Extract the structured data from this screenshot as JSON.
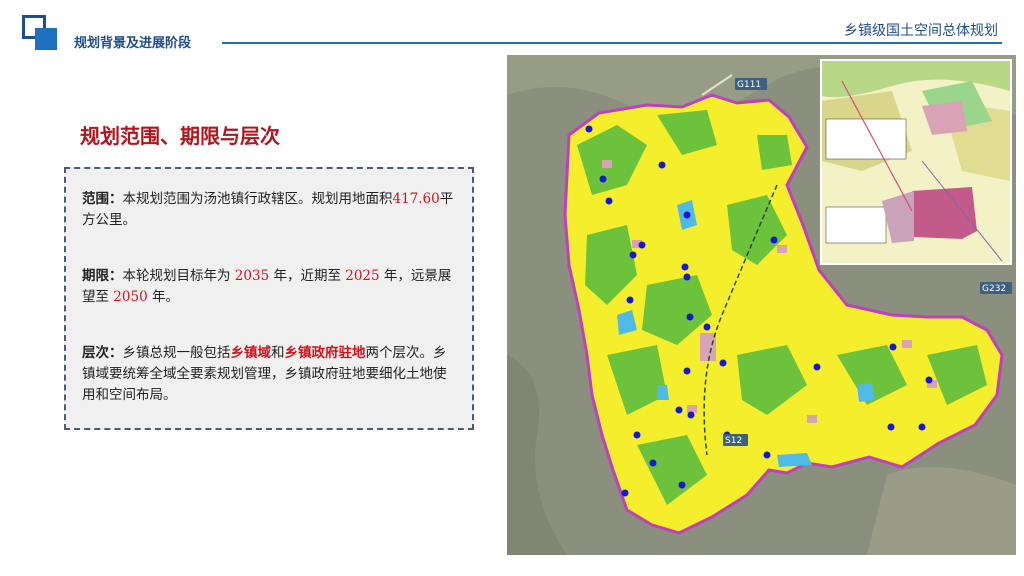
{
  "header": {
    "section_title": "规划背景及进展阶段",
    "doc_title": "乡镇级国土空间总体规划"
  },
  "main": {
    "heading": "规划范围、期限与层次",
    "scope": {
      "label": "范围：",
      "text1": "本规划范围为汤池镇行政辖区。规划用地面积",
      "area": "417.60",
      "text2": "平方公里。"
    },
    "period": {
      "label": "期限：",
      "text1": "本轮规划目标年为 ",
      "target_year": "2035",
      "text2": " 年，近期至 ",
      "near_year": "2025",
      "text3": " 年，远景展望至 ",
      "vision_year": "2050",
      "text4": " 年。"
    },
    "levels": {
      "label": "层次：",
      "text1": "乡镇总规一般包括",
      "highlight1": "乡镇域",
      "text2": "和",
      "highlight2": "乡镇政府驻地",
      "text3": "两个层次。乡镇域要统筹全域全要素规划管理，乡镇政府驻地要细化土地使用和空间布局。"
    }
  },
  "map": {
    "road_labels": [
      "G111",
      "G232",
      "S12"
    ],
    "colors": {
      "satellite": "#8b8f7d",
      "farmland": "#f5ee2c",
      "forest": "#6cc23a",
      "water": "#4fb9e8",
      "settlement": "#d9a3b5",
      "boundary": "#c13fbf",
      "point": "#1717d6"
    }
  }
}
